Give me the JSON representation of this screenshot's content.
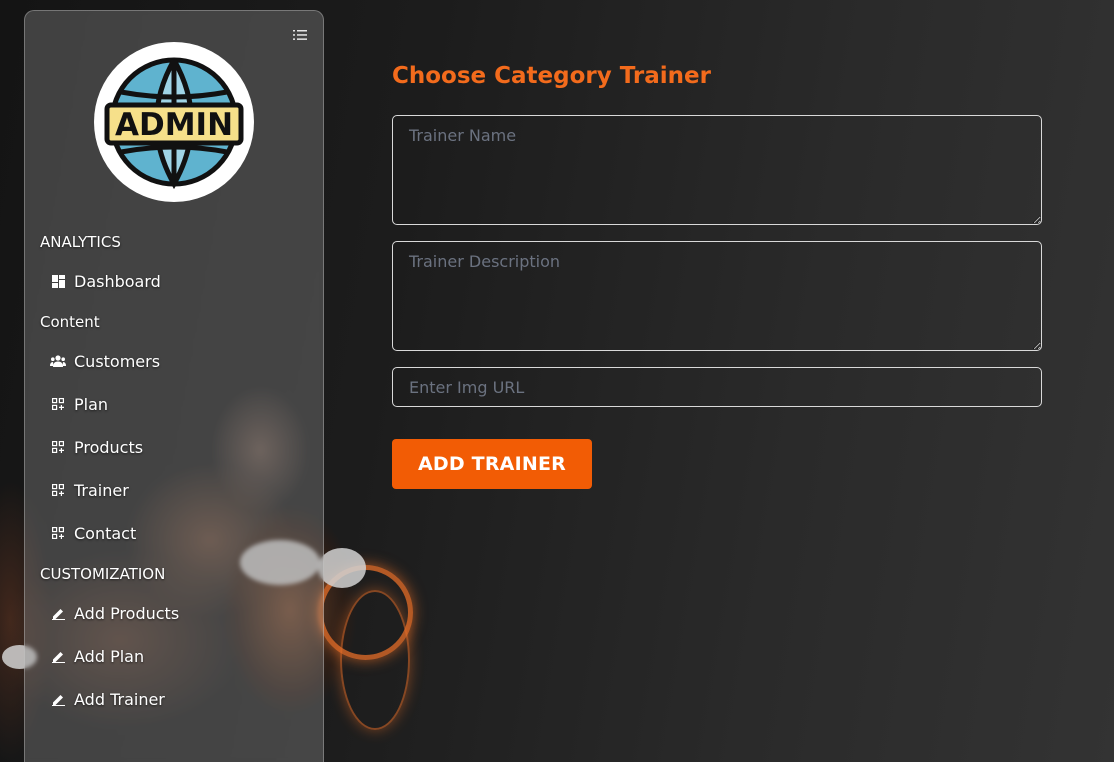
{
  "sidebar": {
    "menu_icon": "list-icon",
    "logo_text": "ADMIN",
    "sections": {
      "analytics": "ANALYTICS",
      "content": "Content",
      "customization": "CUSTOMIZATION"
    },
    "items": {
      "dashboard": "Dashboard",
      "customers": "Customers",
      "plan": "Plan",
      "products": "Products",
      "trainer": "Trainer",
      "contact": "Contact",
      "add_products": "Add Products",
      "add_plan": "Add Plan",
      "add_trainer": "Add Trainer"
    }
  },
  "main": {
    "title": "Choose Category Trainer",
    "fields": {
      "trainer_name_placeholder": "Trainer Name",
      "trainer_description_placeholder": "Trainer Description",
      "img_url_placeholder": "Enter Img URL"
    },
    "submit_label": "ADD TRAINER"
  },
  "colors": {
    "accent": "#f25c05",
    "title": "#f36b1c"
  }
}
